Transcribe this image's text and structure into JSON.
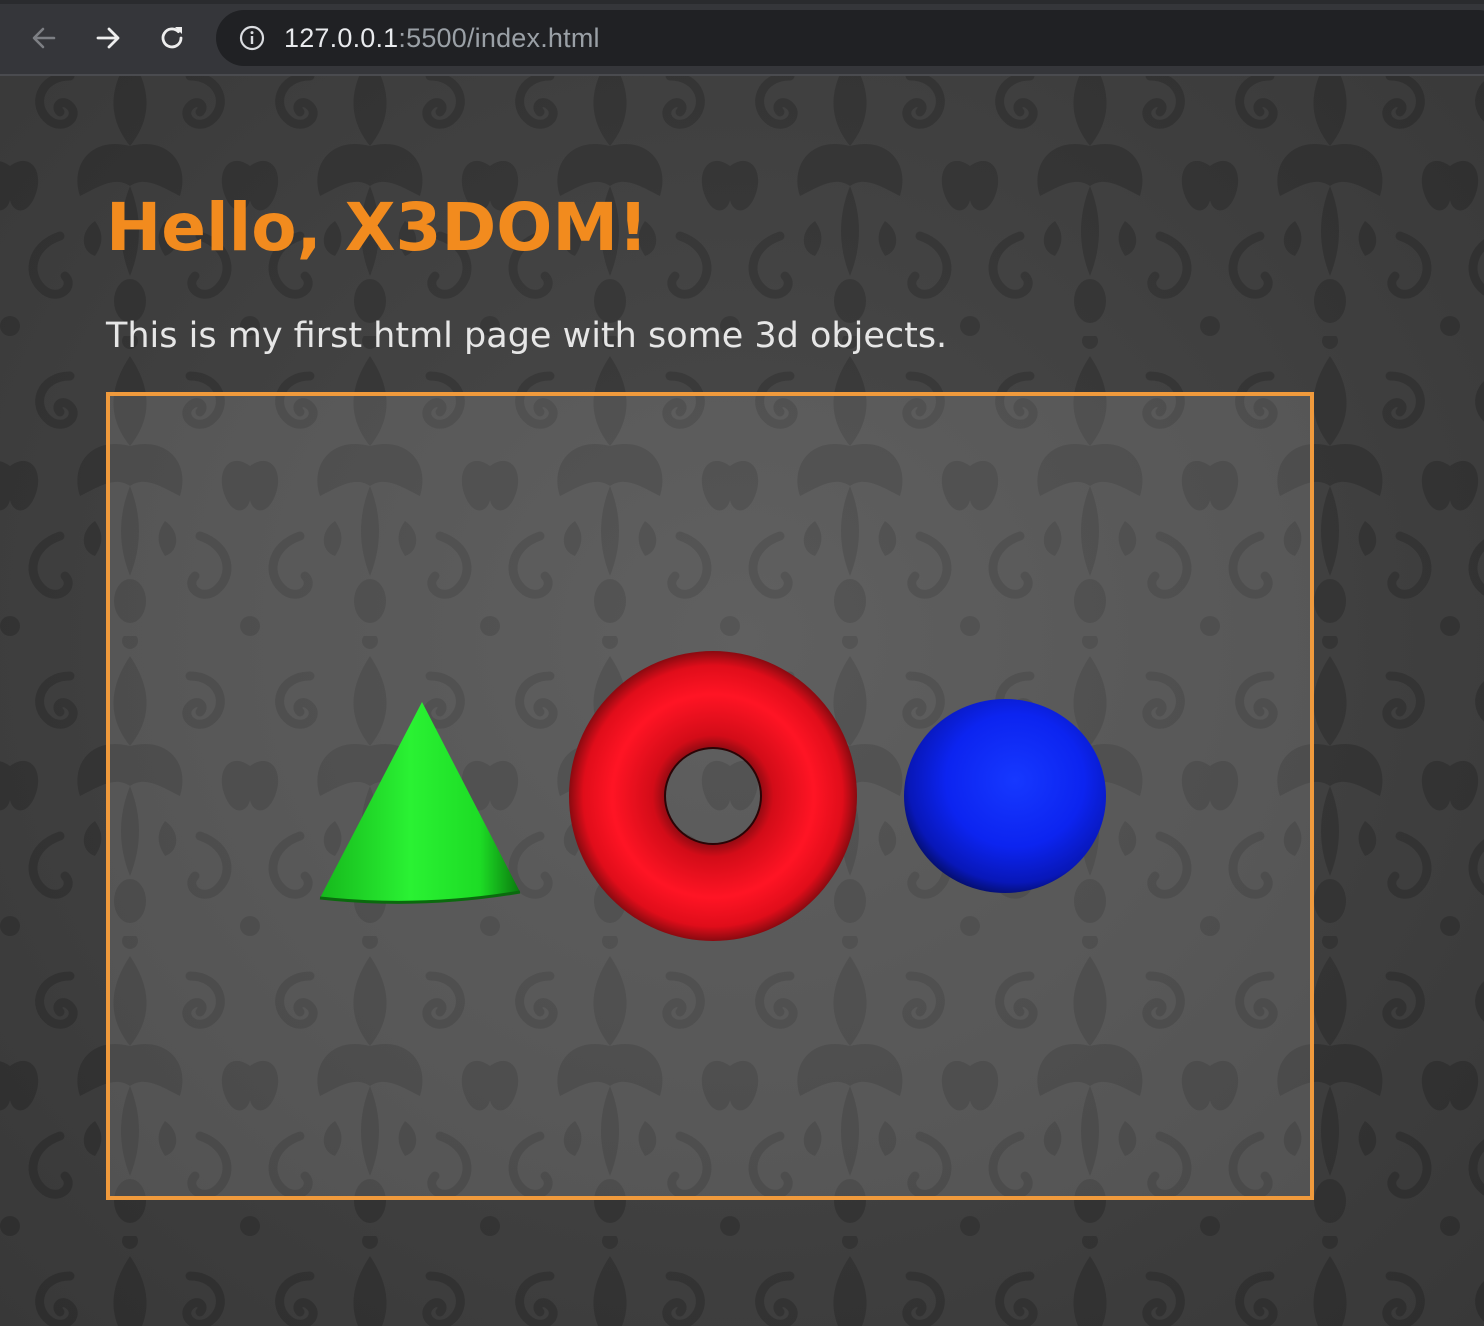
{
  "browser": {
    "url_host": "127.0.0.1",
    "url_rest": ":5500/index.html",
    "icons": {
      "back": "arrow-left-icon",
      "forward": "arrow-right-icon",
      "reload": "reload-icon",
      "info": "info-icon"
    }
  },
  "page": {
    "title": "Hello, X3DOM!",
    "intro": "This is my first html page with some 3d objects.",
    "colors": {
      "title": "#f28b1e",
      "scene_border": "#f09a3c"
    }
  },
  "scene": {
    "objects": [
      {
        "shape": "cone",
        "color": "#22ee2e"
      },
      {
        "shape": "torus",
        "color": "#ee0f1e"
      },
      {
        "shape": "sphere",
        "color": "#0b22ee"
      }
    ]
  }
}
